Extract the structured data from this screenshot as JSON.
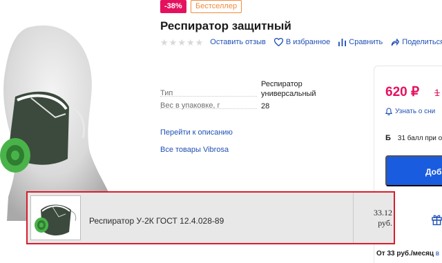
{
  "badges": {
    "discount": "-38%",
    "bestseller": "Бестселлер"
  },
  "product": {
    "title": "Респиратор защитный"
  },
  "actions": {
    "review": "Оставить отзыв",
    "favorite": "В избранное",
    "compare": "Сравнить",
    "share": "Поделиться",
    "rating_stars": 0
  },
  "specs": [
    {
      "key": "Тип",
      "value": "Респиратор универсальный"
    },
    {
      "key": "Вес в упаковке, г",
      "value": "28"
    }
  ],
  "links": {
    "description": "Перейти к описанию",
    "brand": "Все товары Vibrosa"
  },
  "price_card": {
    "price": "620 ₽",
    "old_price": "1",
    "notify": "Узнать о сни",
    "bonus_icon": "Б",
    "bonus": "31 балл при о",
    "add_button": "Доба"
  },
  "installment": {
    "prefix": "От 33 руб./месяц",
    "suffix": "в"
  },
  "overlay_row": {
    "name": "Респиратор У-2К ГОСТ 12.4.028-89",
    "price_value": "33.12",
    "price_unit": "руб."
  },
  "colors": {
    "accent_pink": "#e5115e",
    "link_blue": "#1f4fb5",
    "button_blue": "#1a5ce0",
    "highlight_red": "#d81c2a"
  },
  "icons": [
    "heart-icon",
    "compare-icon",
    "share-icon",
    "bell-icon",
    "gift-icon",
    "star-icon"
  ]
}
